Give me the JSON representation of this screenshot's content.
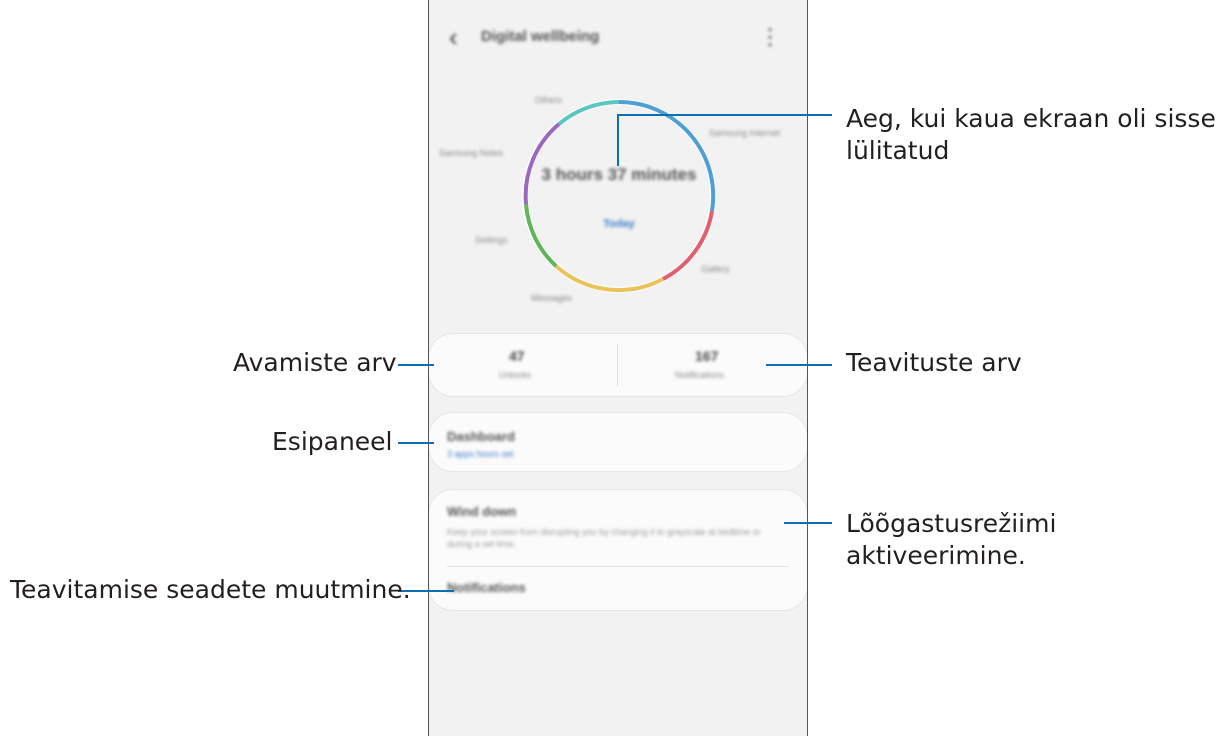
{
  "screen": {
    "title": "Digital wellbeing",
    "back_icon": "‹",
    "more_icon": "⋮"
  },
  "chart": {
    "total_time": "3 hours 37 minutes",
    "period_link": "Today",
    "apps": [
      {
        "name": "Others"
      },
      {
        "name": "Samsung Internet"
      },
      {
        "name": "Samsung Notes"
      },
      {
        "name": "Settings"
      },
      {
        "name": "Gallery"
      },
      {
        "name": "Messages"
      }
    ],
    "colors": {
      "blue": "#4d9fd6",
      "red": "#e06070",
      "yellow": "#e9c25a",
      "green": "#5fb55a",
      "purple": "#9a68c0",
      "teal": "#5cc6c2"
    }
  },
  "stats": {
    "unlocks_value": "47",
    "unlocks_label": "Unlocks",
    "notifications_value": "167",
    "notifications_label": "Notifications"
  },
  "dashboard": {
    "title": "Dashboard",
    "subtitle": "3 apps hours set"
  },
  "wind_down": {
    "title": "Wind down",
    "description": "Keep your screen from disrupting you by changing it to grayscale at bedtime or during a set time."
  },
  "notifications_item": {
    "title": "Notifications"
  },
  "callouts": {
    "screen_time": "Aeg, kui kaua ekraan oli sisse lülitatud",
    "unlocks": "Avamiste arv",
    "notifications": "Teavituste arv",
    "dashboard": "Esipaneel",
    "wind_down": "Lõõgastusrežiimi aktiveerimine.",
    "notification_settings": "Teavitamise seadete muutmine."
  }
}
